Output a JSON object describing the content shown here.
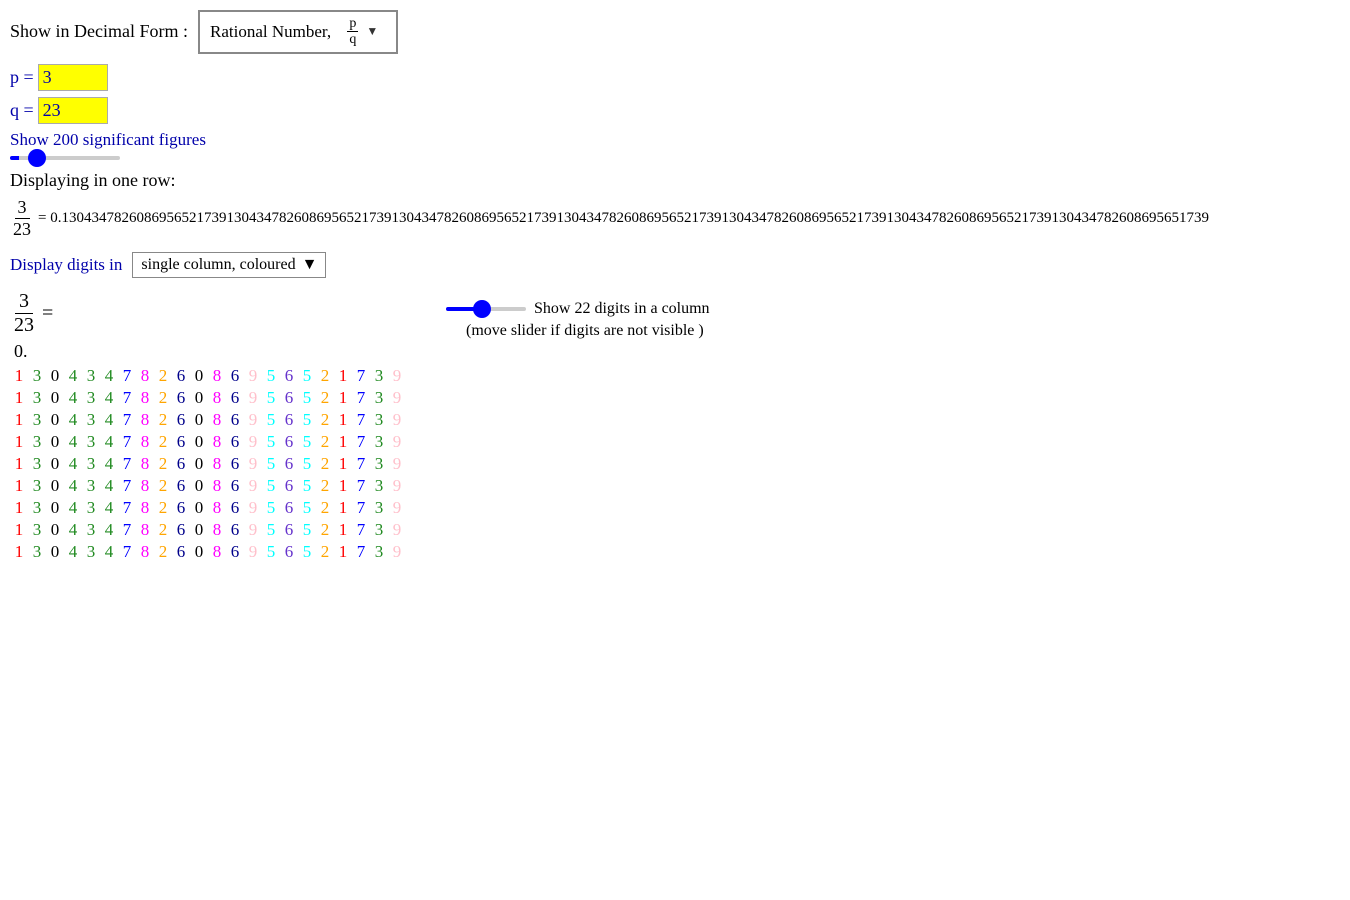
{
  "header": {
    "show_decimal_label": "Show in Decimal Form :",
    "dropdown_label": "Rational Number,",
    "dropdown_fraction_num": "p",
    "dropdown_fraction_den": "q"
  },
  "inputs": {
    "p_label": "p =",
    "q_label": "q =",
    "p_value": "3",
    "q_value": "23"
  },
  "sig_figs": {
    "label": "Show 200 significant figures"
  },
  "displaying": {
    "label": "Displaying in one row:",
    "fraction_num": "3",
    "fraction_den": "23",
    "equals": "= 0.130434782608695652173913043478260869565217391304347826086956521739130434782608695652173913043478260869565217391304347826086956521739130434782608695651739"
  },
  "display_digits": {
    "label": "Display digits in",
    "dropdown_value": "single column, coloured"
  },
  "column_section": {
    "fraction_num": "3",
    "fraction_den": "23",
    "equals": "=",
    "zero_dot": "0.",
    "show_digits_label": "Show 22 digits in a column",
    "move_slider_label": "(move slider if digits are not visible  )"
  },
  "repeating_pattern": [
    1,
    3,
    0,
    4,
    3,
    4,
    7,
    8,
    2,
    6,
    0,
    8,
    6,
    9,
    5,
    6,
    5,
    2,
    1,
    7,
    3,
    9
  ]
}
